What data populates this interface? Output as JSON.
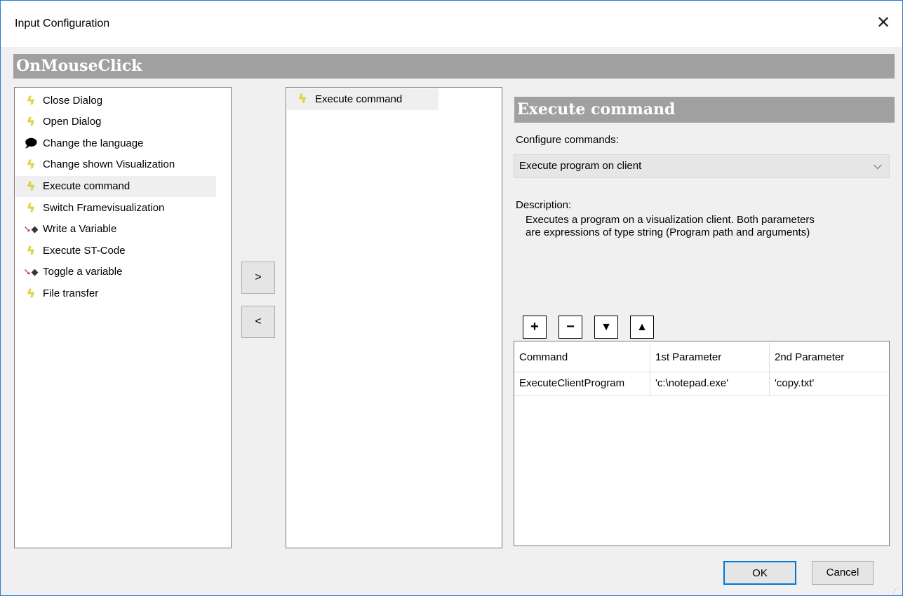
{
  "window": {
    "title": "Input Configuration",
    "close_label": "✕"
  },
  "event": {
    "name": "OnMouseClick"
  },
  "available_actions": [
    {
      "label": "Close Dialog",
      "icon": "bolt-icon"
    },
    {
      "label": "Open Dialog",
      "icon": "bolt-icon"
    },
    {
      "label": "Change the language",
      "icon": "speech-bubble-icon"
    },
    {
      "label": "Change shown Visualization",
      "icon": "bolt-icon"
    },
    {
      "label": "Execute command",
      "icon": "bolt-icon",
      "selected": true
    },
    {
      "label": "Switch Framevisualization",
      "icon": "bolt-icon"
    },
    {
      "label": "Write a Variable",
      "icon": "variable-write-icon"
    },
    {
      "label": "Execute ST-Code",
      "icon": "bolt-icon"
    },
    {
      "label": "Toggle a variable",
      "icon": "variable-write-icon"
    },
    {
      "label": "File transfer",
      "icon": "bolt-icon"
    }
  ],
  "transfer_buttons": {
    "add": ">",
    "remove": "<"
  },
  "configured_actions": [
    {
      "label": "Execute command",
      "icon": "bolt-icon"
    }
  ],
  "details": {
    "title": "Execute command",
    "configure_label": "Configure commands:",
    "command_select_value": "Execute program on client",
    "description_label": "Description:",
    "description_text": "Executes a program on a visualization client. Both parameters are expressions of type string (Program path and arguments)"
  },
  "command_toolbar": {
    "add": "+",
    "remove": "−",
    "move_down": "▼",
    "move_up": "▲"
  },
  "command_table": {
    "columns": [
      "Command",
      "1st Parameter",
      "2nd Parameter"
    ],
    "rows": [
      [
        "ExecuteClientProgram",
        "'c:\\notepad.exe'",
        "'copy.txt'"
      ]
    ]
  },
  "footer": {
    "ok": "OK",
    "cancel": "Cancel"
  },
  "colors": {
    "accent": "#0078d7",
    "header_gray": "#a0a0a0",
    "bolt_yellow": "#f3e000"
  }
}
